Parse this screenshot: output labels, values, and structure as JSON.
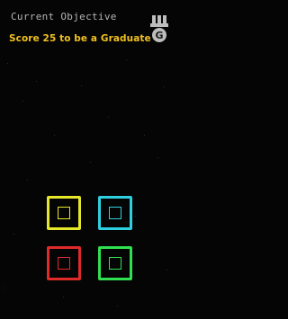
{
  "objective": {
    "label": "Current Objective",
    "text": "Score 25 to be a Graduate",
    "label_color": "#b5b5b5",
    "text_color": "#f0c020"
  },
  "rank_badge": {
    "icon": "graduate-rank-badge-icon",
    "letter": "G",
    "color": "#bdbdbd"
  },
  "pads": [
    {
      "name": "yellow",
      "color": "#e6e62a"
    },
    {
      "name": "cyan",
      "color": "#2ed0e0"
    },
    {
      "name": "red",
      "color": "#e02a2a"
    },
    {
      "name": "green",
      "color": "#30e050"
    }
  ]
}
